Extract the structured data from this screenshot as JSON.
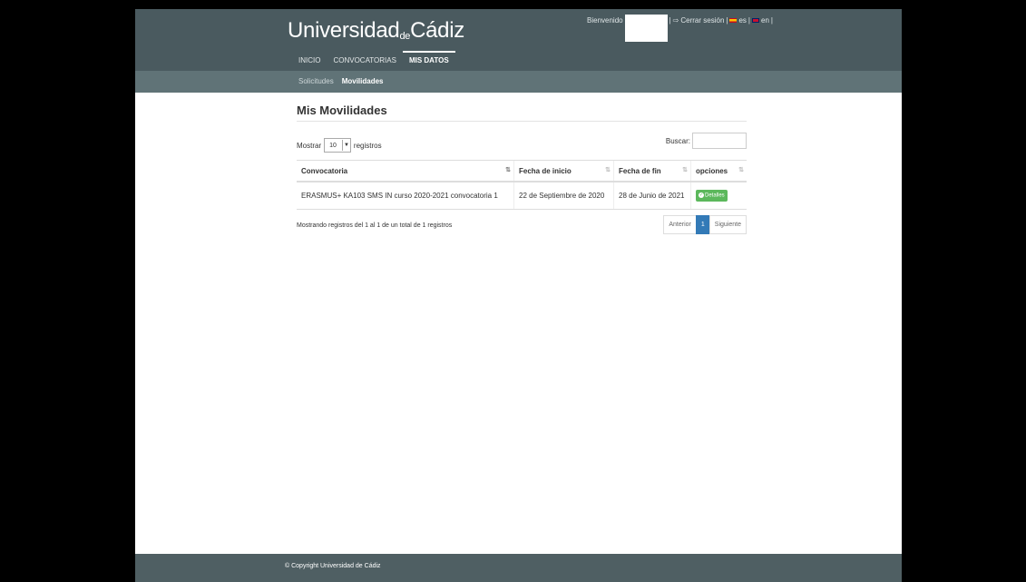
{
  "header": {
    "logo": {
      "a": "Universidad",
      "b": "de",
      "c": "Cádiz"
    },
    "nav": [
      "INICIO",
      "CONVOCATORIAS",
      "MIS DATOS"
    ],
    "welcome": "Bienvenido",
    "logout": "Cerrar sesión",
    "langs": [
      "es",
      "en"
    ]
  },
  "subnav": {
    "items": [
      "Solicitudes",
      "Movilidades"
    ]
  },
  "main": {
    "title": "Mis Movilidades",
    "show_label": "Mostrar",
    "page_size": "10",
    "records_label": "registros",
    "search_label": "Buscar:",
    "search_value": "",
    "columns": [
      "Convocatoria",
      "Fecha de inicio",
      "Fecha de fin",
      "opciones"
    ],
    "rows": [
      {
        "convocatoria": "ERASMUS+ KA103 SMS IN curso 2020-2021 convocatoria 1",
        "inicio": "22 de Septiembre de 2020",
        "fin": "28 de Junio de 2021",
        "accion": "Detalles"
      }
    ],
    "info": "Mostrando registros del 1 al 1 de un total de 1 registros",
    "pager": {
      "prev": "Anterior",
      "current": "1",
      "next": "Siguiente"
    }
  },
  "footer": {
    "copyright": "© Copyright Universidad de Cádiz"
  },
  "colors": {
    "header": "#4a5a5f",
    "subnav": "#607377",
    "accent": "#337ab7",
    "success": "#5cb85c"
  }
}
